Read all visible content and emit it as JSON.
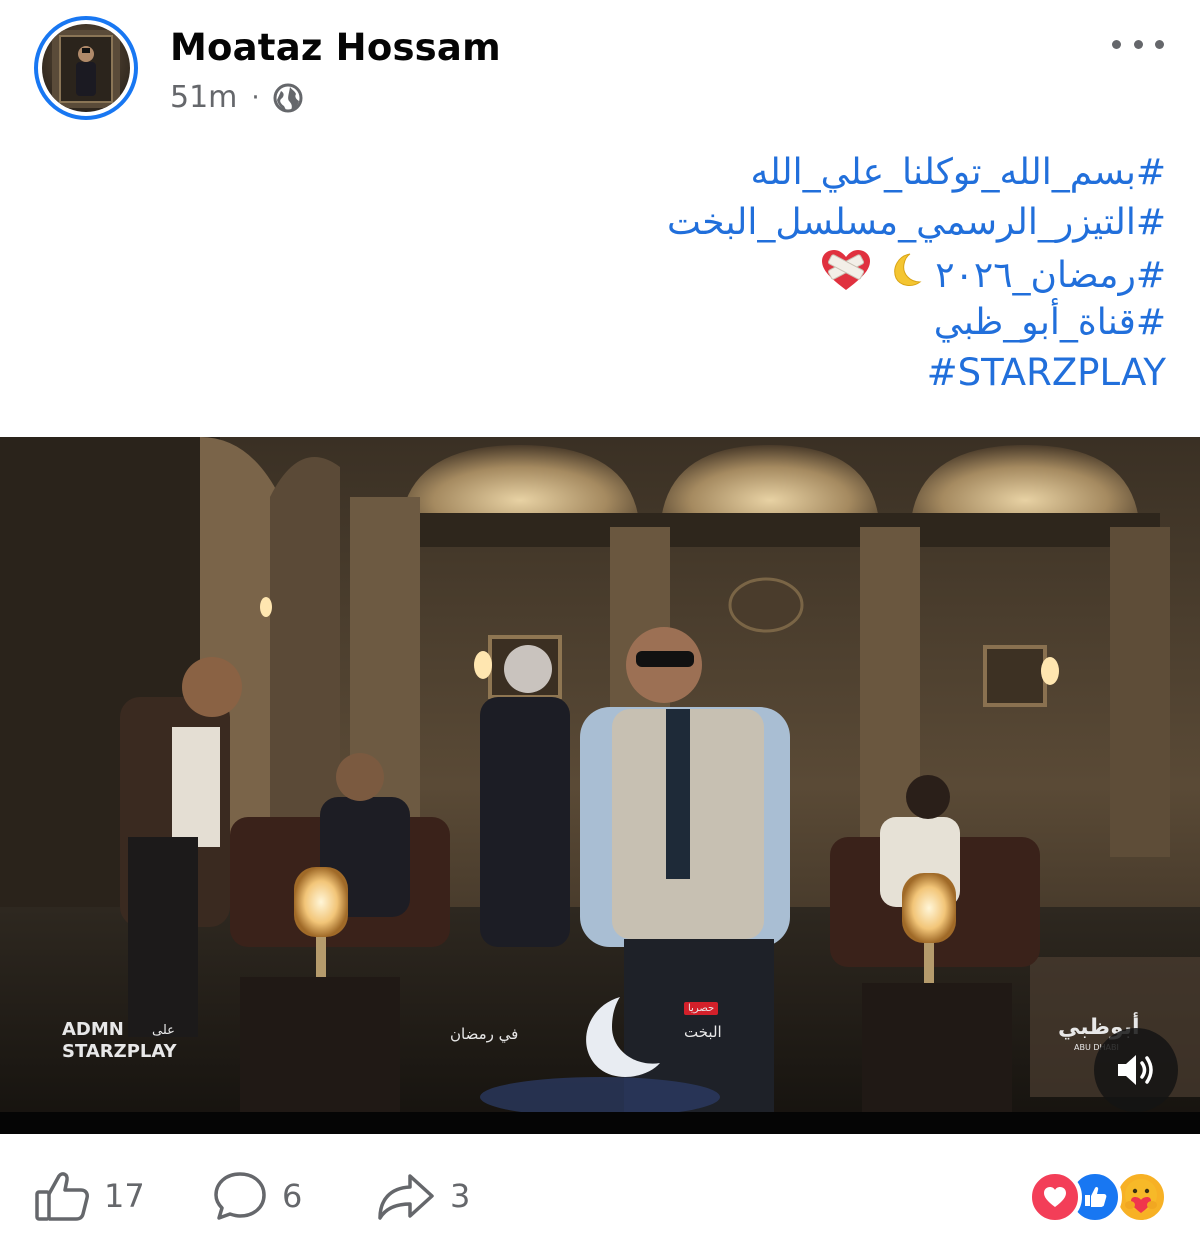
{
  "post": {
    "author": "Moataz Hossam",
    "timestamp": "51m",
    "separator": "·",
    "privacy_icon": "globe-icon",
    "hashtags": [
      "#بسم_الله_توكلنا_علي_الله",
      "#التيزر_الرسمي_مسلسل_البخت",
      "#رمضان_٢٠٢٦",
      "#قناة_أبو_ظبي",
      "#STARZPLAY"
    ]
  },
  "video": {
    "watermarks": {
      "admn": "ADMN",
      "on_label": "على",
      "starzplay": "STARZPLAY",
      "in_ramadan": "في رمضان",
      "exclusive": "حصريا",
      "series_title": "البخت",
      "abudhabi": "أبوظبي",
      "abudhabi_sub": "ABU DHABI"
    },
    "sound_icon": "speaker-icon"
  },
  "footer": {
    "likes": "17",
    "comments": "6",
    "shares": "3",
    "reactions": [
      "love",
      "like",
      "care"
    ]
  },
  "colors": {
    "accent": "#1877f2",
    "hashtag": "#216fdb",
    "muted": "#65676b"
  }
}
